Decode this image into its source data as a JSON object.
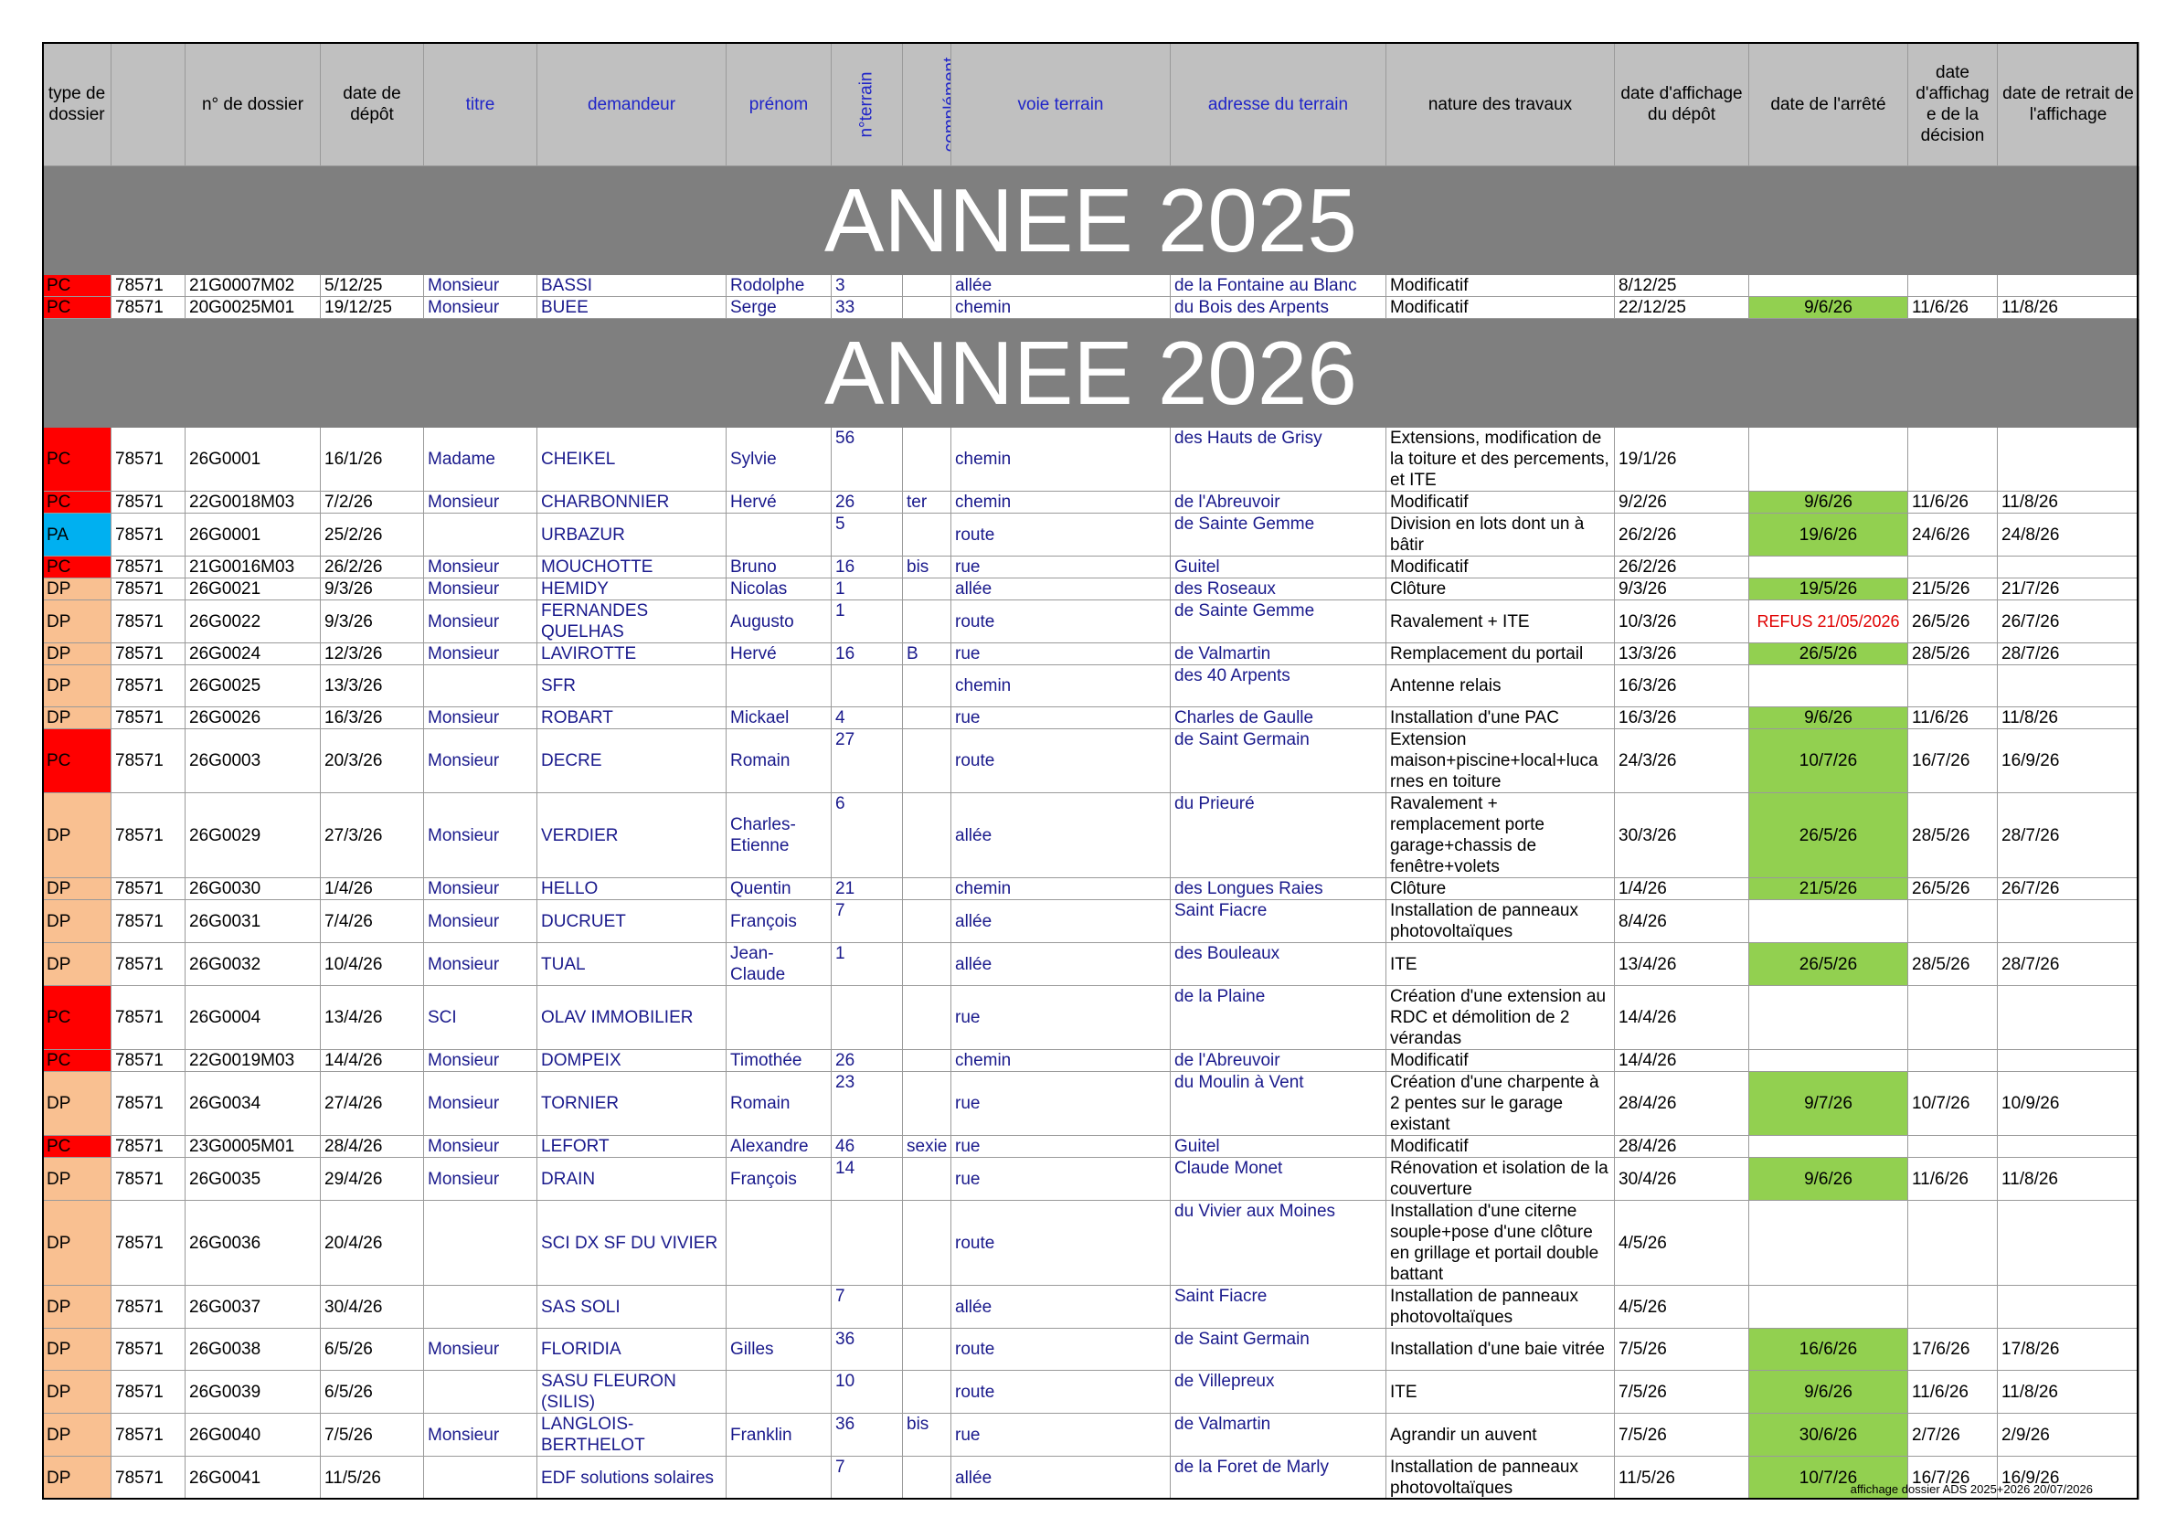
{
  "header": {
    "type_dossier": "type de dossier",
    "blank": "",
    "num_dossier": "n° de dossier",
    "date_depot": "date de dépôt",
    "titre": "titre",
    "demandeur": "demandeur",
    "prenom": "prénom",
    "n_terrain": "n°terrain",
    "complement": "complément",
    "voie_terrain": "voie terrain",
    "adresse_terrain": "adresse du terrain",
    "nature_travaux": "nature des travaux",
    "date_affichage_depot": "date d'affichage du dépôt",
    "date_arrete": "date de l'arrêté",
    "date_affichage_decision": "date d'affichag e de la décision",
    "date_retrait": "date de retrait de l'affichage"
  },
  "years": [
    "ANNEE 2025",
    "ANNEE 2026"
  ],
  "rows_2025": [
    {
      "type": "PC",
      "commune": "78571",
      "dossier": "21G0007M02",
      "depot": "5/12/25",
      "titre": "Monsieur",
      "demandeur": "BASSI",
      "prenom": "Rodolphe",
      "num": "3",
      "comp": "",
      "voie": "allée",
      "adresse": "de la Fontaine au Blanc",
      "nature": "Modificatif",
      "aff_depot": "8/12/25",
      "arrete": "",
      "aff_decision": "",
      "retrait": ""
    },
    {
      "type": "PC",
      "commune": "78571",
      "dossier": "20G0025M01",
      "depot": "19/12/25",
      "titre": "Monsieur",
      "demandeur": "BUEE",
      "prenom": "Serge",
      "num": "33",
      "comp": "",
      "voie": "chemin",
      "adresse": "du Bois des Arpents",
      "nature": "Modificatif",
      "aff_depot": "22/12/25",
      "arrete": "9/6/26",
      "aff_decision": "11/6/26",
      "retrait": "11/8/26"
    }
  ],
  "rows_2026": [
    {
      "type": "PC",
      "commune": "78571",
      "dossier": "26G0001",
      "depot": "16/1/26",
      "titre": "Madame",
      "demandeur": "CHEIKEL",
      "prenom": "Sylvie",
      "num": "56",
      "comp": "",
      "voie": "chemin",
      "adresse": "des Hauts de Grisy",
      "nature": "Extensions, modification de la toiture et des percements, et ITE",
      "aff_depot": "19/1/26",
      "arrete": "",
      "aff_decision": "",
      "retrait": ""
    },
    {
      "type": "PC",
      "commune": "78571",
      "dossier": "22G0018M03",
      "depot": "7/2/26",
      "titre": "Monsieur",
      "demandeur": "CHARBONNIER",
      "prenom": "Hervé",
      "num": "26",
      "comp": "ter",
      "voie": "chemin",
      "adresse": "de l'Abreuvoir",
      "nature": "Modificatif",
      "aff_depot": "9/2/26",
      "arrete": "9/6/26",
      "aff_decision": "11/6/26",
      "retrait": "11/8/26"
    },
    {
      "type": "PA",
      "commune": "78571",
      "dossier": "26G0001",
      "depot": "25/2/26",
      "titre": "",
      "demandeur": "URBAZUR",
      "prenom": "",
      "num": "5",
      "comp": "",
      "voie": "route",
      "adresse": "de Sainte Gemme",
      "nature": "Division en lots dont un à bâtir",
      "aff_depot": "26/2/26",
      "arrete": "19/6/26",
      "aff_decision": "24/6/26",
      "retrait": "24/8/26"
    },
    {
      "type": "PC",
      "commune": "78571",
      "dossier": "21G0016M03",
      "depot": "26/2/26",
      "titre": "Monsieur",
      "demandeur": "MOUCHOTTE",
      "prenom": "Bruno",
      "num": "16",
      "comp": "bis",
      "voie": "rue",
      "adresse": "Guitel",
      "nature": "Modificatif",
      "aff_depot": "26/2/26",
      "arrete": "",
      "aff_decision": "",
      "retrait": ""
    },
    {
      "type": "DP",
      "commune": "78571",
      "dossier": "26G0021",
      "depot": "9/3/26",
      "titre": "Monsieur",
      "demandeur": "HEMIDY",
      "prenom": "Nicolas",
      "num": "1",
      "comp": "",
      "voie": "allée",
      "adresse": "des Roseaux",
      "nature": "Clôture",
      "aff_depot": "9/3/26",
      "arrete": "19/5/26",
      "aff_decision": "21/5/26",
      "retrait": "21/7/26"
    },
    {
      "type": "DP",
      "commune": "78571",
      "dossier": "26G0022",
      "depot": "9/3/26",
      "titre": "Monsieur",
      "demandeur": "FERNANDES QUELHAS",
      "prenom": "Augusto",
      "num": "1",
      "comp": "",
      "voie": "route",
      "adresse": " de Sainte Gemme",
      "nature": "Ravalement + ITE",
      "aff_depot": "10/3/26",
      "arrete": "REFUS 21/05/2026",
      "aff_decision": "26/5/26",
      "retrait": "26/7/26"
    },
    {
      "type": "DP",
      "commune": "78571",
      "dossier": "26G0024",
      "depot": "12/3/26",
      "titre": "Monsieur",
      "demandeur": "LAVIROTTE",
      "prenom": "Hervé",
      "num": "16",
      "comp": "B",
      "voie": "rue",
      "adresse": "de Valmartin",
      "nature": "Remplacement du portail",
      "aff_depot": "13/3/26",
      "arrete": "26/5/26",
      "aff_decision": "28/5/26",
      "retrait": "28/7/26"
    },
    {
      "type": "DP",
      "commune": "78571",
      "dossier": "26G0025",
      "depot": "13/3/26",
      "titre": "",
      "demandeur": "SFR",
      "prenom": "",
      "num": "",
      "comp": "",
      "voie": "chemin",
      "adresse": "des 40 Arpents",
      "nature": "Antenne relais",
      "aff_depot": "16/3/26",
      "arrete": "",
      "aff_decision": "",
      "retrait": ""
    },
    {
      "type": "DP",
      "commune": "78571",
      "dossier": "26G0026",
      "depot": "16/3/26",
      "titre": "Monsieur",
      "demandeur": "ROBART",
      "prenom": "Mickael",
      "num": "4",
      "comp": "",
      "voie": "rue",
      "adresse": "Charles de Gaulle",
      "nature": "Installation d'une PAC",
      "aff_depot": "16/3/26",
      "arrete": "9/6/26",
      "aff_decision": "11/6/26",
      "retrait": "11/8/26"
    },
    {
      "type": "PC",
      "commune": "78571",
      "dossier": "26G0003",
      "depot": "20/3/26",
      "titre": "Monsieur",
      "demandeur": "DECRE",
      "prenom": "Romain",
      "num": "27",
      "comp": "",
      "voie": "route",
      "adresse": "de Saint Germain",
      "nature": "Extension maison+piscine+local+luca rnes en toiture",
      "aff_depot": "24/3/26",
      "arrete": "10/7/26",
      "aff_decision": "16/7/26",
      "retrait": "16/9/26"
    },
    {
      "type": "DP",
      "commune": "78571",
      "dossier": "26G0029",
      "depot": "27/3/26",
      "titre": "Monsieur",
      "demandeur": "VERDIER",
      "prenom": "Charles-Etienne",
      "num": "6",
      "comp": "",
      "voie": "allée",
      "adresse": "du Prieuré",
      "nature": "Ravalement + remplacement porte garage+chassis de fenêtre+volets",
      "aff_depot": "30/3/26",
      "arrete": "26/5/26",
      "aff_decision": "28/5/26",
      "retrait": "28/7/26"
    },
    {
      "type": "DP",
      "commune": "78571",
      "dossier": "26G0030",
      "depot": "1/4/26",
      "titre": "Monsieur",
      "demandeur": "HELLO",
      "prenom": "Quentin",
      "num": "21",
      "comp": "",
      "voie": "chemin",
      "adresse": "des Longues Raies",
      "nature": "Clôture",
      "aff_depot": "1/4/26",
      "arrete": "21/5/26",
      "aff_decision": "26/5/26",
      "retrait": "26/7/26"
    },
    {
      "type": "DP",
      "commune": "78571",
      "dossier": "26G0031",
      "depot": "7/4/26",
      "titre": "Monsieur",
      "demandeur": "DUCRUET",
      "prenom": "François",
      "num": "7",
      "comp": "",
      "voie": "allée",
      "adresse": "Saint Fiacre",
      "nature": "Installation de panneaux photovoltaïques",
      "aff_depot": "8/4/26",
      "arrete": "",
      "aff_decision": "",
      "retrait": ""
    },
    {
      "type": "DP",
      "commune": "78571",
      "dossier": "26G0032",
      "depot": "10/4/26",
      "titre": "Monsieur",
      "demandeur": "TUAL",
      "prenom": "Jean-Claude",
      "num": "1",
      "comp": "",
      "voie": "allée",
      "adresse": "des Bouleaux",
      "nature": "ITE",
      "aff_depot": "13/4/26",
      "arrete": "26/5/26",
      "aff_decision": "28/5/26",
      "retrait": "28/7/26"
    },
    {
      "type": "PC",
      "commune": "78571",
      "dossier": "26G0004",
      "depot": "13/4/26",
      "titre": "SCI",
      "demandeur": "OLAV IMMOBILIER",
      "prenom": "",
      "num": "",
      "comp": "",
      "voie": "rue",
      "adresse": "de la Plaine",
      "nature": "Création d'une extension au RDC et démolition de 2 vérandas",
      "aff_depot": "14/4/26",
      "arrete": "",
      "aff_decision": "",
      "retrait": ""
    },
    {
      "type": "PC",
      "commune": "78571",
      "dossier": "22G0019M03",
      "depot": "14/4/26",
      "titre": "Monsieur",
      "demandeur": "DOMPEIX",
      "prenom": "Timothée",
      "num": "26",
      "comp": "",
      "voie": "chemin",
      "adresse": "de l'Abreuvoir",
      "nature": "Modificatif",
      "aff_depot": "14/4/26",
      "arrete": "",
      "aff_decision": "",
      "retrait": ""
    },
    {
      "type": "DP",
      "commune": "78571",
      "dossier": "26G0034",
      "depot": "27/4/26",
      "titre": "Monsieur",
      "demandeur": "TORNIER",
      "prenom": "Romain",
      "num": "23",
      "comp": "",
      "voie": "rue",
      "adresse": "du Moulin à Vent",
      "nature": "Création d'une charpente à 2 pentes sur le garage existant",
      "aff_depot": "28/4/26",
      "arrete": "9/7/26",
      "aff_decision": "10/7/26",
      "retrait": "10/9/26"
    },
    {
      "type": "PC",
      "commune": "78571",
      "dossier": "23G0005M01",
      "depot": "28/4/26",
      "titre": "Monsieur",
      "demandeur": "LEFORT",
      "prenom": "Alexandre",
      "num": "46",
      "comp": "sexie",
      "voie": "rue",
      "adresse": "Guitel",
      "nature": "Modificatif",
      "aff_depot": "28/4/26",
      "arrete": "",
      "aff_decision": "",
      "retrait": ""
    },
    {
      "type": "DP",
      "commune": "78571",
      "dossier": "26G0035",
      "depot": "29/4/26",
      "titre": "Monsieur",
      "demandeur": "DRAIN",
      "prenom": "François",
      "num": "14",
      "comp": "",
      "voie": "rue",
      "adresse": "Claude Monet",
      "nature": "Rénovation et isolation de la couverture",
      "aff_depot": "30/4/26",
      "arrete": "9/6/26",
      "aff_decision": "11/6/26",
      "retrait": "11/8/26"
    },
    {
      "type": "DP",
      "commune": "78571",
      "dossier": "26G0036",
      "depot": "20/4/26",
      "titre": "",
      "demandeur": "SCI DX SF DU VIVIER",
      "prenom": "",
      "num": "",
      "comp": "",
      "voie": "route",
      "adresse": "du Vivier aux Moines",
      "nature": "Installation d'une citerne souple+pose d'une clôture en grillage et portail double battant",
      "aff_depot": "4/5/26",
      "arrete": "",
      "aff_decision": "",
      "retrait": ""
    },
    {
      "type": "DP",
      "commune": "78571",
      "dossier": "26G0037",
      "depot": "30/4/26",
      "titre": "",
      "demandeur": "SAS SOLI",
      "prenom": "",
      "num": "7",
      "comp": "",
      "voie": "allée",
      "adresse": "Saint Fiacre",
      "nature": "Installation de panneaux photovoltaïques",
      "aff_depot": "4/5/26",
      "arrete": "",
      "aff_decision": "",
      "retrait": ""
    },
    {
      "type": "DP",
      "commune": "78571",
      "dossier": "26G0038",
      "depot": "6/5/26",
      "titre": "Monsieur",
      "demandeur": "FLORIDIA",
      "prenom": "Gilles",
      "num": "36",
      "comp": "",
      "voie": "route",
      "adresse": "de Saint Germain",
      "nature": "Installation d'une baie vitrée",
      "aff_depot": "7/5/26",
      "arrete": "16/6/26",
      "aff_decision": "17/6/26",
      "retrait": "17/8/26"
    },
    {
      "type": "DP",
      "commune": "78571",
      "dossier": "26G0039",
      "depot": "6/5/26",
      "titre": "",
      "demandeur": "SASU FLEURON (SILIS)",
      "prenom": "",
      "num": "10",
      "comp": "",
      "voie": "route",
      "adresse": "de Villepreux",
      "nature": "ITE",
      "aff_depot": "7/5/26",
      "arrete": "9/6/26",
      "aff_decision": "11/6/26",
      "retrait": "11/8/26"
    },
    {
      "type": "DP",
      "commune": "78571",
      "dossier": "26G0040",
      "depot": "7/5/26",
      "titre": "Monsieur",
      "demandeur": "LANGLOIS-BERTHELOT",
      "prenom": "Franklin",
      "num": "36",
      "comp": "bis",
      "voie": "rue",
      "adresse": "de Valmartin",
      "nature": "Agrandir un auvent",
      "aff_depot": "7/5/26",
      "arrete": "30/6/26",
      "aff_decision": "2/7/26",
      "retrait": "2/9/26"
    },
    {
      "type": "DP",
      "commune": "78571",
      "dossier": "26G0041",
      "depot": "11/5/26",
      "titre": "",
      "demandeur": "EDF solutions solaires",
      "prenom": "",
      "num": "7",
      "comp": "",
      "voie": "allée",
      "adresse": "de la Foret de Marly",
      "nature": "Installation de panneaux photovoltaïques",
      "aff_depot": "11/5/26",
      "arrete": "10/7/26",
      "aff_decision": "16/7/26",
      "retrait": "16/9/26"
    }
  ],
  "footer": "affichage dossier ADS 2025+2026 20/07/2026",
  "colors": {
    "PC": "#ff0000",
    "PA": "#00b0f0",
    "DP": "#f9c091",
    "arrete": "#92d050",
    "year_band": "#7f7f7f",
    "header": "#c0c0c0",
    "refus": "#e00000"
  }
}
